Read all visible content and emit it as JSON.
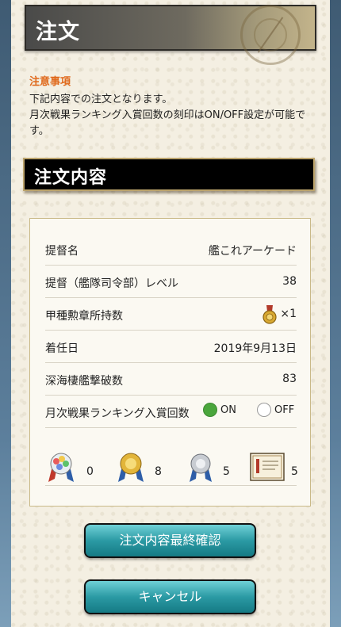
{
  "header": {
    "title": "注文"
  },
  "notice": {
    "heading": "注意事項",
    "line1": "下記内容での注文となります。",
    "line2": "月次戦果ランキング入賞回数の刻印はON/OFF設定が可能です。"
  },
  "section": {
    "title": "注文内容"
  },
  "order": {
    "admiral_name_label": "提督名",
    "admiral_name_value": "艦これアーケード",
    "level_label": "提督（艦隊司令部）レベル",
    "level_value": "38",
    "medal_label": "甲種勲章所持数",
    "medal_value": "×1",
    "appointed_label": "着任日",
    "appointed_value": "2019年9月13日",
    "abyssal_label": "深海棲艦撃破数",
    "abyssal_value": "83",
    "ranking_label": "月次戦果ランキング入賞回数",
    "toggle_on": "ON",
    "toggle_off": "OFF",
    "ranking_on_selected": true,
    "ranking_counts": [
      "0",
      "8",
      "5",
      "5"
    ]
  },
  "buttons": {
    "confirm": "注文内容最終確認",
    "cancel": "キャンセル"
  },
  "colors": {
    "notice_heading": "#e06a1d",
    "toggle_on": "#4aa63c",
    "button": "#2b9aa4"
  }
}
